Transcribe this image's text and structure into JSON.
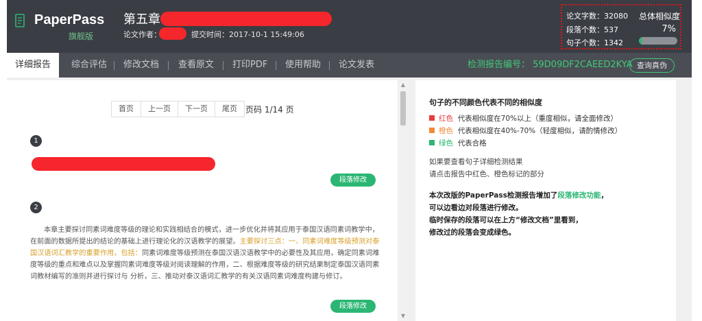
{
  "header": {
    "brand": "PaperPass",
    "edition": "旗舰版",
    "doc_title": "第五章",
    "author_label": "论文作者：",
    "submit_time": "提交时间：2017-10-1 15:49:06",
    "stats": {
      "word_count": "论文字数：32080",
      "paragraph_count": "段落个数：537",
      "sentence_count": "句子个数：1342",
      "similarity_label": "总体相似度",
      "similarity_value": "7%",
      "similarity_fraction": 0.07
    },
    "colors": {
      "bg": "#3a3d44",
      "accent": "#2bb673",
      "redaction": "#f5262c"
    }
  },
  "nav": {
    "tabs": [
      {
        "label": "详细报告",
        "active": true
      },
      {
        "label": "综合评估"
      },
      {
        "label": "修改文档"
      },
      {
        "label": "查看原文"
      },
      {
        "label": "打印PDF"
      },
      {
        "label": "使用帮助"
      },
      {
        "label": "论文发表"
      }
    ],
    "report_no": "检测报告编号： 59D09DF2CAEED2KYA",
    "verify_button": "查询真伪"
  },
  "pager": {
    "first": "首页",
    "prev": "上一页",
    "next": "下一页",
    "last": "尾页",
    "page_info": "页码 1/14 页"
  },
  "sections": [
    {
      "number": "1",
      "button": "段落修改"
    },
    {
      "number": "2",
      "button": "段落修改",
      "text_normal_1": "本章主要探讨同素词难度等级的理论和实践相结合的模式，进一步优化并将其应用于泰国汉语同素词教学中，在前面的数据所提出的结论的基础上进行理论化的汉语教学的展望。",
      "text_orange_1": "主要探讨三点：一、同素词难度等级预测对泰国汉语词汇教学的重要作用，包括：",
      "text_normal_2": "同素词难度等级预测在泰国汉语汉语教学中的必要性及其应用，确定同素词难度等级的重点和难点以及掌握同素词难度等级对阅读理解的作用，二、根据难度等级的研究结果制定泰国汉语同素词教材编写的准则并进行探讨与 分析，三、推动对泰汉语词汇教学的有关汉语同素词难度构建与修订。"
    }
  ],
  "legend": {
    "title": "句子的不同颜色代表不同的相似度",
    "items": [
      {
        "color_name": "红色",
        "desc": "代表相似度在70%以上（重度相似，请全面修改）",
        "color": "#e83b3b"
      },
      {
        "color_name": "橙色",
        "desc": "代表相似度在40%-70%（轻度相似，请酌情修改）",
        "color": "#f08a3a"
      },
      {
        "color_name": "绿色",
        "desc": "代表合格",
        "color": "#2bb673"
      }
    ],
    "hint_1": "如果要查看句子详细检测结果",
    "hint_2": "请点击报告中红色、橙色标记的部分",
    "note_1a": "本次改版的PaperPass检测报告增加了",
    "note_1b": "段落修改功能",
    "note_1c": "，",
    "note_2": "可以边看边对段落进行修改。",
    "note_3": "临时保存的段落可以在上方“修改文档”里看到，",
    "note_4": "修改过的段落会变成绿色。"
  }
}
